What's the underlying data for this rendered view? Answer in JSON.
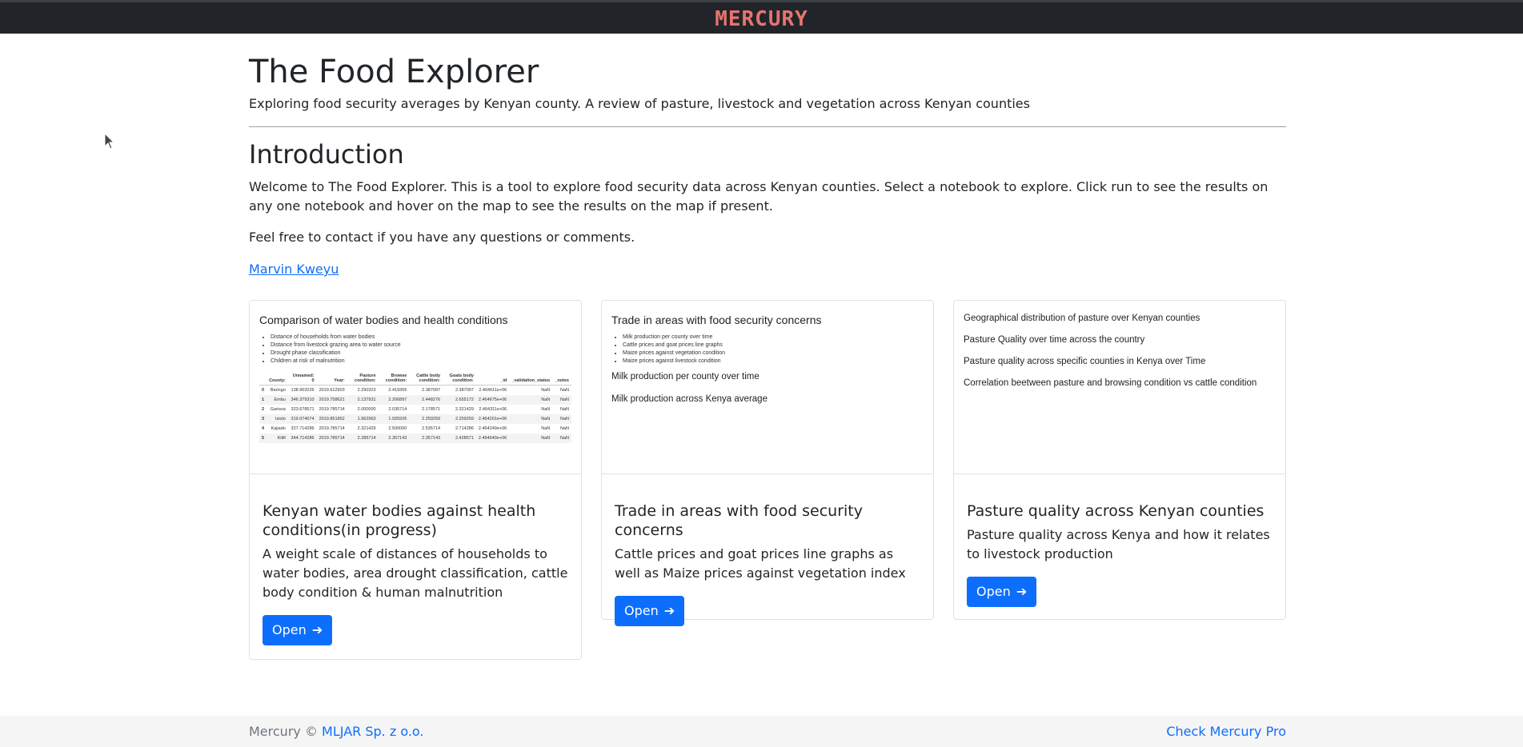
{
  "header": {
    "brand": "MERCURY"
  },
  "page": {
    "title": "The Food Explorer",
    "subtitle": "Exploring food security averages by Kenyan county. A review of pasture, livestock and vegetation across Kenyan counties",
    "section_title": "Introduction",
    "intro": "Welcome to The Food Explorer. This is a tool to explore food security data across Kenyan counties. Select a notebook to explore. Click run to see the results on any one notebook and hover on the map to see the results on the map if present.",
    "contact": "Feel free to contact if you have any questions or comments.",
    "author_link": "Marvin Kweyu"
  },
  "cards": [
    {
      "preview": {
        "heading": "Comparison of water bodies and health conditions",
        "bullets": [
          "Distance of households from water bodies",
          "Distance from livestock grazing area to water source",
          "Drought phase classification",
          "Children at risk of malnutrition"
        ],
        "table": {
          "columns": [
            "",
            "County:",
            "Unnamed: 0",
            "Year:",
            "Pasture condition:",
            "Browse condition:",
            "Cattle body condition:",
            "Goats body condition:",
            "_id",
            "_validation_status",
            "_notes"
          ],
          "rows": [
            [
              "0",
              "Baringo",
              "138.903226",
              "2019.612903",
              "2.290323",
              "2.419355",
              "2.387097",
              "2.387097",
              "2.464611e+06",
              "NaN",
              "NaN"
            ],
            [
              "1",
              "Embu",
              "346.379310",
              "2019.758621",
              "2.137931",
              "2.206897",
              "2.448276",
              "2.655172",
              "2.464675e+06",
              "NaN",
              "NaN"
            ],
            [
              "2",
              "Garissa",
              "323.678571",
              "2019.785714",
              "2.000000",
              "2.035714",
              "2.178571",
              "2.321429",
              "2.464311e+06",
              "NaN",
              "NaN"
            ],
            [
              "3",
              "Isiolo",
              "319.074074",
              "2019.851852",
              "1.962963",
              "1.925926",
              "2.259259",
              "2.259259",
              "2.464201e+06",
              "NaN",
              "NaN"
            ],
            [
              "4",
              "Kajiado",
              "327.714286",
              "2019.785714",
              "2.321429",
              "2.500000",
              "2.535714",
              "2.714286",
              "2.464249e+06",
              "NaN",
              "NaN"
            ],
            [
              "5",
              "Kilifi",
              "344.714286",
              "2019.785714",
              "2.285714",
              "2.357143",
              "2.357143",
              "2.428571",
              "2.464640e+06",
              "NaN",
              "NaN"
            ]
          ]
        }
      },
      "title": "Kenyan water bodies against health conditions(in progress)",
      "text": "A weight scale of distances of households to water bodies, area drought classification, cattle body condition & human malnutrition",
      "button": "Open"
    },
    {
      "preview": {
        "heading": "Trade in areas with food security concerns",
        "bullets": [
          "Milk production per county over time",
          "Cattle prices and goat prices line graphs",
          "Maize prices against vegetation condition",
          "Maize prices against livestock condition"
        ],
        "lines": [
          "Milk production per county over time",
          "Milk production across Kenya average"
        ]
      },
      "title": "Trade in areas with food security concerns",
      "text": "Cattle prices and goat prices line graphs as well as Maize prices against vegetation index",
      "button": "Open"
    },
    {
      "preview": {
        "lines": [
          "Geographical distribution of pasture over Kenyan counties",
          "Pasture Quality over time across the country",
          "Pasture quality across specific counties in Kenya over Time",
          "Correlation beetween pasture and browsing condition vs cattle condition"
        ]
      },
      "title": "Pasture quality across Kenyan counties",
      "text": "Pasture quality across Kenya and how it relates to livestock production",
      "button": "Open"
    }
  ],
  "footer": {
    "left_prefix": "Mercury ©",
    "left_link": "MLJAR Sp. z o.o.",
    "right_link": "Check Mercury Pro"
  },
  "icons": {
    "arrow": "arrow-right-icon",
    "cursor": "mouse-pointer-icon"
  }
}
